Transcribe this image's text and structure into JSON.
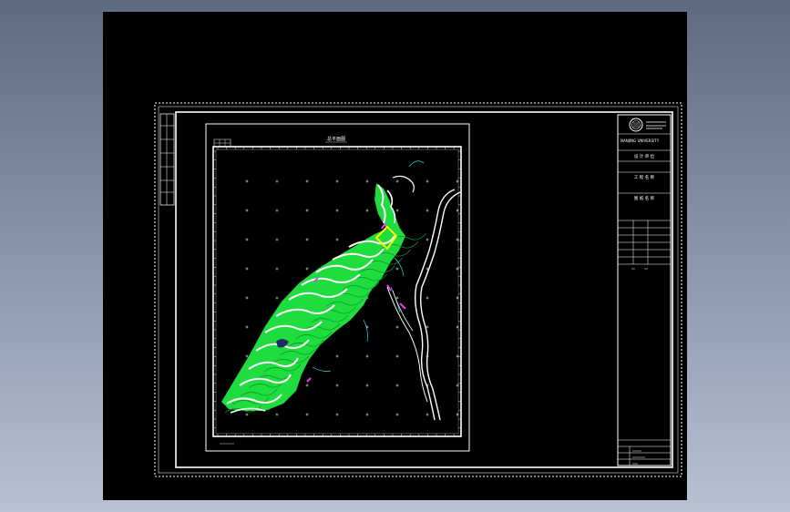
{
  "drawing": {
    "map_title": "总平面图",
    "scale_left": "",
    "scale_center": "",
    "scale_right": ""
  },
  "title_block": {
    "institution_line1": "NANJING UNIVERSITY",
    "institution_line2": "",
    "design_unit_label": "设 计 单 位",
    "project_name_label": "工 程 名 称",
    "project_name": "",
    "drawing_name_label": "图 纸 名 称",
    "drawing_name_line1": "",
    "drawing_name_line2": "",
    "roles": [
      "",
      "",
      "",
      "",
      "",
      ""
    ],
    "footer_rows": [
      "",
      "",
      "",
      ""
    ]
  },
  "colors": {
    "contour": "#22ee44",
    "terrace": "#ffffff",
    "highlight": "#ffff00",
    "accent_magenta": "#ff33ff",
    "accent_cyan": "#33dddd",
    "frame": "#ffffff"
  }
}
